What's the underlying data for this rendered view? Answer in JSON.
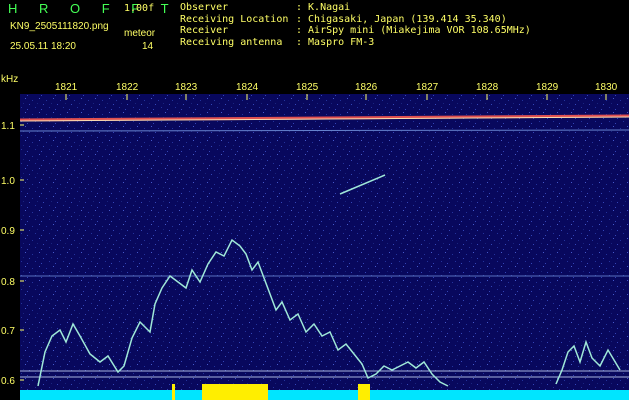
{
  "header": {
    "brand": "H R O F F T",
    "version": "1.00f",
    "filename": "KN9_2505111820.png",
    "mode_label": "meteor",
    "timestamp": "25.05.11 18:20",
    "count": "14"
  },
  "meta": [
    {
      "key": "Observer",
      "value": ": K.Nagai"
    },
    {
      "key": "Receiving Location",
      "value": ": Chigasaki, Japan (139.414 35.340)"
    },
    {
      "key": "Receiver",
      "value": ": AirSpy mini (Miakejima VOR 108.65MHz)"
    },
    {
      "key": "Receiving antenna",
      "value": ": Maspro FM-3"
    }
  ],
  "axis": {
    "unit": "kHz",
    "y_ticks": [
      "1.1",
      "1.0",
      "0.9",
      "0.8",
      "0.7",
      "0.6"
    ],
    "x_ticks": [
      "1821",
      "1822",
      "1823",
      "1824",
      "1825",
      "1826",
      "1827",
      "1828",
      "1829",
      "1830"
    ]
  },
  "colors": {
    "background": "#000000",
    "label": "#ffff66",
    "brand": "#44ff55",
    "waterfall": "#0a0a6e",
    "signal": "#9fe8d8",
    "baseline": "#00e5ff",
    "burst": "#ffee00"
  }
}
